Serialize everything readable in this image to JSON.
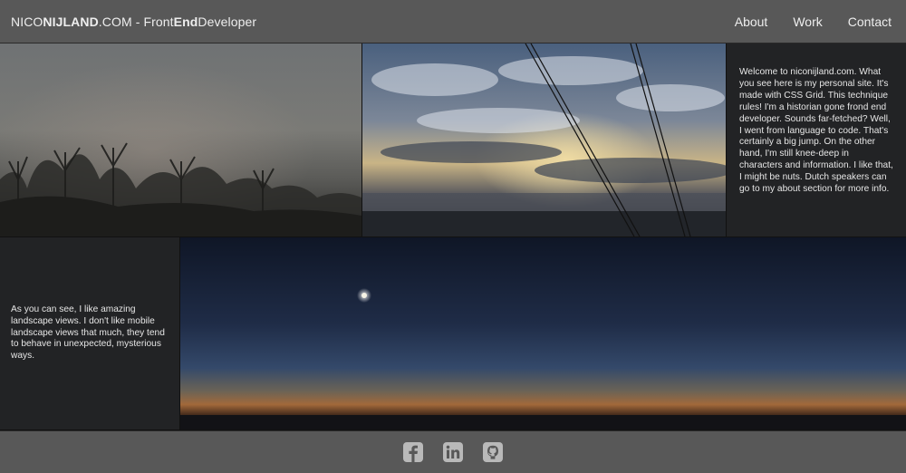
{
  "header": {
    "brand_prefix": "NICO",
    "brand_bold": "NIJLAND",
    "brand_suffix": ".COM - Front",
    "brand_end": "End",
    "brand_tail": "Developer",
    "nav": [
      {
        "label": "About"
      },
      {
        "label": "Work"
      },
      {
        "label": "Contact"
      }
    ]
  },
  "intro_text": "Welcome to niconijland.com. What you see here is my personal site. It's made with CSS Grid. This technique rules! I'm a historian gone frond end developer. Sounds far-fetched? Well, I went from language to code. That's certainly a big jump. On the other hand, I'm still knee-deep in characters and information. I like that, I might be nuts. Dutch speakers can go to my about section for more info.",
  "aside_text": "As you can see, I like amazing landscape views. I don't like mobile landscape views that much, they tend to behave in unexpected, mysterious ways.",
  "images": [
    {
      "name": "foggy-trees-photo"
    },
    {
      "name": "cloudy-sky-powerlines-photo"
    },
    {
      "name": "dusk-moon-horizon-photo"
    }
  ],
  "footer": {
    "icons": [
      "facebook-icon",
      "linkedin-icon",
      "github-icon"
    ]
  },
  "colors": {
    "header_bg": "#585858",
    "panel_bg": "#222325",
    "icon_fill": "#b9b9b9"
  }
}
